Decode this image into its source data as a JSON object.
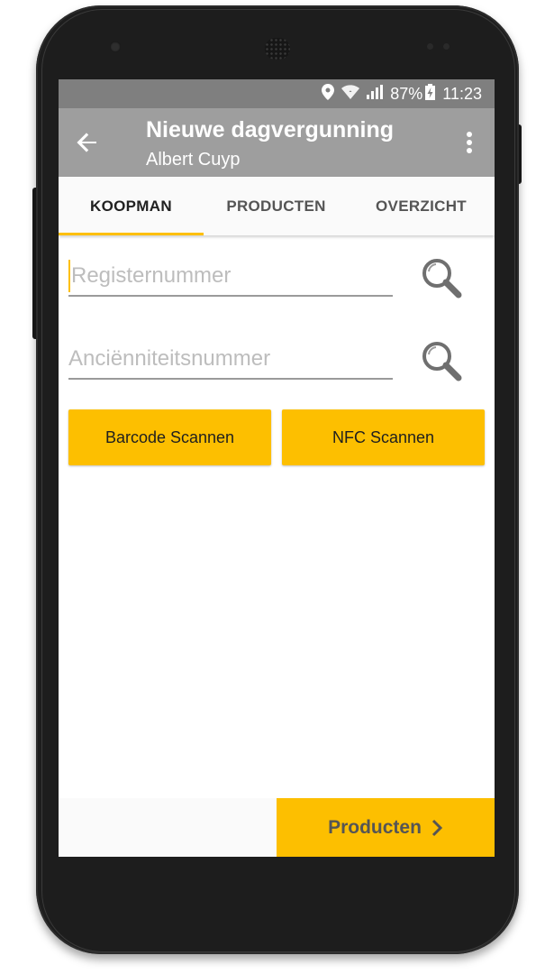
{
  "statusbar": {
    "battery": "87%",
    "time": "11:23",
    "icons": [
      "location-icon",
      "wifi-icon",
      "cell-signal-icon",
      "battery-charging-icon"
    ]
  },
  "appbar": {
    "title": "Nieuwe dagvergunning",
    "subtitle": "Albert Cuyp",
    "back_icon": "arrow-left-icon",
    "menu_icon": "more-vertical-icon"
  },
  "tabs": [
    {
      "label": "KOOPMAN",
      "active": true
    },
    {
      "label": "PRODUCTEN",
      "active": false
    },
    {
      "label": "OVERZICHT",
      "active": false
    }
  ],
  "form": {
    "registernummer": {
      "value": "",
      "placeholder": "Registernummer"
    },
    "ancienniteitsnummer": {
      "value": "",
      "placeholder": "Anciënniteitsnummer"
    }
  },
  "buttons": {
    "barcode": "Barcode Scannen",
    "nfc": "NFC Scannen",
    "next": "Producten"
  },
  "colors": {
    "accent": "#fdbf00",
    "appbar": "#9e9e9e",
    "statusbar": "#7f7f7f"
  }
}
